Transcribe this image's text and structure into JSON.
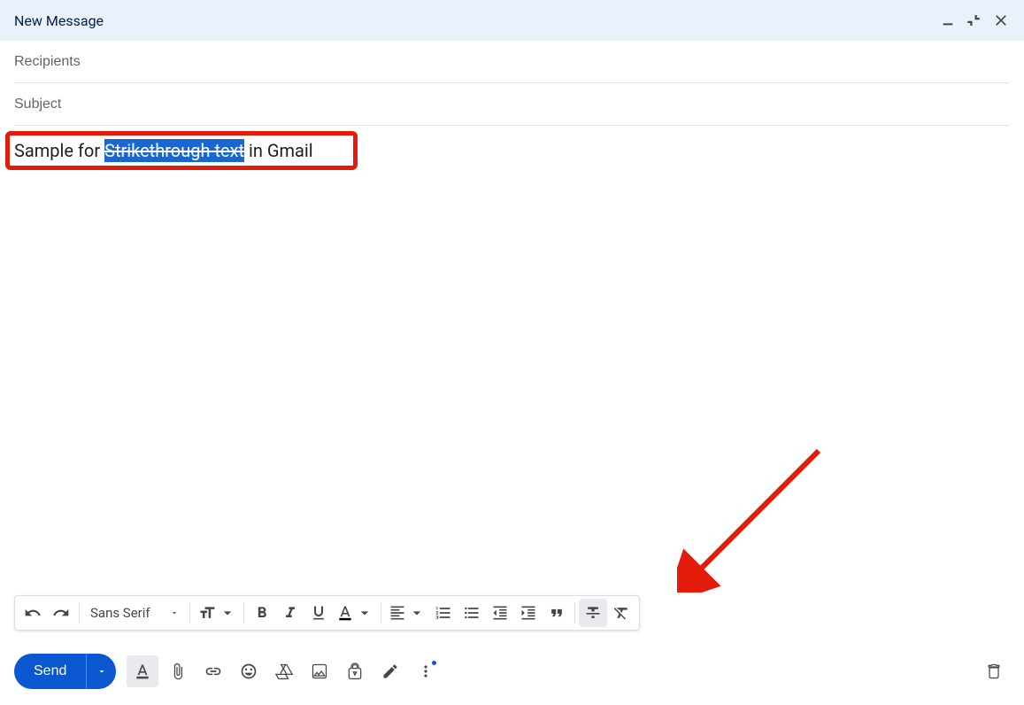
{
  "header": {
    "title": "New Message"
  },
  "fields": {
    "recipients_placeholder": "Recipients",
    "subject_placeholder": "Subject"
  },
  "body": {
    "prefix": "Sample for ",
    "strike_text": "Strikethrough text",
    "suffix": " in Gmail"
  },
  "toolbar": {
    "font_name": "Sans Serif"
  },
  "send": {
    "label": "Send"
  }
}
